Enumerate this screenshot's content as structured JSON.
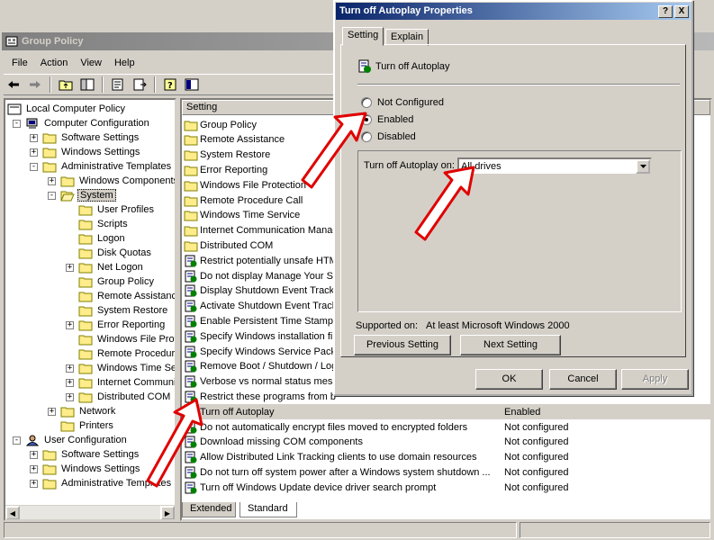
{
  "main_window": {
    "title": "Group Policy",
    "menu": [
      "File",
      "Action",
      "View",
      "Help"
    ]
  },
  "tree": {
    "root": "Local Computer Policy",
    "computer_config": "Computer Configuration",
    "software_settings": "Software Settings",
    "windows_settings": "Windows Settings",
    "admin_templates": "Administrative Templates",
    "windows_components": "Windows Components",
    "system": "System",
    "user_profiles": "User Profiles",
    "scripts": "Scripts",
    "logon": "Logon",
    "disk_quotas": "Disk Quotas",
    "net_logon": "Net Logon",
    "group_policy": "Group Policy",
    "remote_assistance": "Remote Assistance",
    "system_restore": "System Restore",
    "error_reporting": "Error Reporting",
    "windows_file_protection": "Windows File Prote",
    "remote_procedure": "Remote Procedure",
    "windows_time": "Windows Time Serv",
    "internet_communic": "Internet Communic",
    "distributed_com": "Distributed COM",
    "network": "Network",
    "printers": "Printers",
    "user_config": "User Configuration",
    "u_software_settings": "Software Settings",
    "u_windows_settings": "Windows Settings",
    "u_admin_templates": "Administrative Templates"
  },
  "list": {
    "col_setting": "Setting",
    "col_state": "",
    "rows": [
      {
        "name": "Group Policy",
        "state": "",
        "kind": "folder"
      },
      {
        "name": "Remote Assistance",
        "state": "",
        "kind": "folder"
      },
      {
        "name": "System Restore",
        "state": "",
        "kind": "folder"
      },
      {
        "name": "Error Reporting",
        "state": "",
        "kind": "folder"
      },
      {
        "name": "Windows File Protection",
        "state": "",
        "kind": "folder"
      },
      {
        "name": "Remote Procedure Call",
        "state": "",
        "kind": "folder"
      },
      {
        "name": "Windows Time Service",
        "state": "",
        "kind": "folder"
      },
      {
        "name": "Internet Communication Manag",
        "state": "",
        "kind": "folder"
      },
      {
        "name": "Distributed COM",
        "state": "",
        "kind": "folder"
      },
      {
        "name": "Restrict potentially unsafe HTM",
        "state": "",
        "kind": "policy"
      },
      {
        "name": "Do not display Manage Your Ser",
        "state": "",
        "kind": "policy"
      },
      {
        "name": "Display Shutdown Event Tracke",
        "state": "",
        "kind": "policy"
      },
      {
        "name": "Activate Shutdown Event Track",
        "state": "",
        "kind": "policy"
      },
      {
        "name": "Enable Persistent Time Stamp",
        "state": "",
        "kind": "policy"
      },
      {
        "name": "Specify Windows installation file",
        "state": "",
        "kind": "policy"
      },
      {
        "name": "Specify Windows Service Pack in",
        "state": "",
        "kind": "policy"
      },
      {
        "name": "Remove Boot / Shutdown / Log",
        "state": "",
        "kind": "policy"
      },
      {
        "name": "Verbose vs normal status messa",
        "state": "",
        "kind": "policy"
      },
      {
        "name": "Restrict these programs from b",
        "state": "",
        "kind": "policy"
      },
      {
        "name": "Turn off Autoplay",
        "state": "Enabled",
        "kind": "policy"
      },
      {
        "name": "Do not automatically encrypt files moved to encrypted folders",
        "state": "Not configured",
        "kind": "policy"
      },
      {
        "name": "Download missing COM components",
        "state": "Not configured",
        "kind": "policy"
      },
      {
        "name": "Allow Distributed Link Tracking clients to use domain resources",
        "state": "Not configured",
        "kind": "policy"
      },
      {
        "name": "Do not turn off system power after a Windows system shutdown ...",
        "state": "Not configured",
        "kind": "policy"
      },
      {
        "name": "Turn off Windows Update device driver search prompt",
        "state": "Not configured",
        "kind": "policy"
      }
    ]
  },
  "bottom_tabs": {
    "extended": "Extended",
    "standard": "Standard"
  },
  "dialog": {
    "title": "Turn off Autoplay Properties",
    "help_btn": "?",
    "close_btn": "X",
    "tab_setting": "Setting",
    "tab_explain": "Explain",
    "policy_name": "Turn off Autoplay",
    "radio_not_configured": "Not Configured",
    "radio_enabled": "Enabled",
    "radio_disabled": "Disabled",
    "option_label": "Turn off Autoplay on:",
    "option_value": "All drives",
    "supported_label": "Supported on:",
    "supported_value": "At least Microsoft Windows 2000",
    "prev_btn": "Previous Setting",
    "next_btn": "Next Setting",
    "ok_btn": "OK",
    "cancel_btn": "Cancel",
    "apply_btn": "Apply"
  },
  "colors": {
    "dialog_title": "#0a246a",
    "arrow": "#e00000"
  }
}
